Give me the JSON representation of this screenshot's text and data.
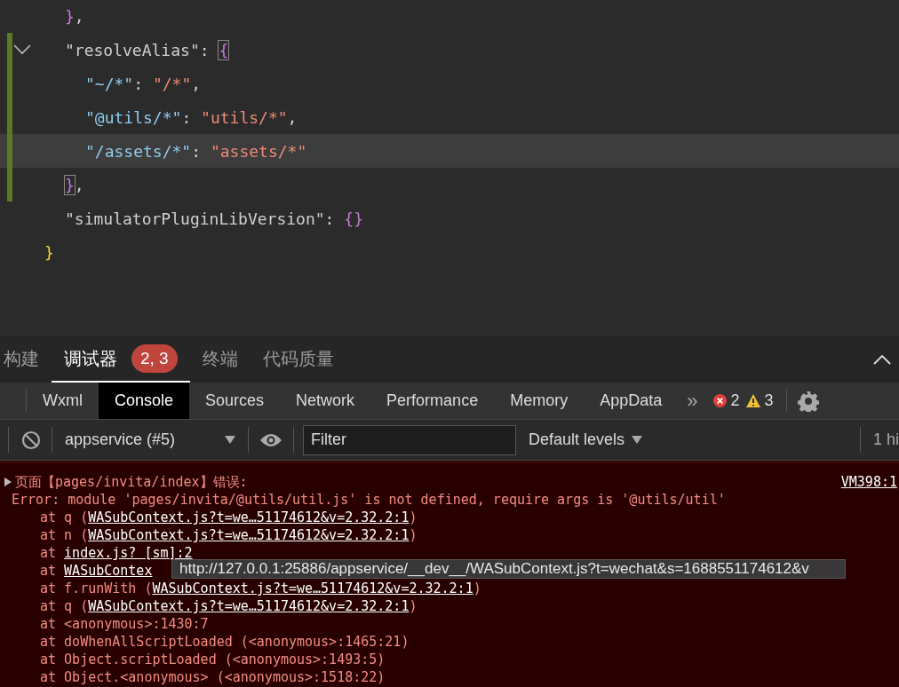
{
  "editor": {
    "lines": [
      {
        "modified": false,
        "current": false,
        "tokens": [
          {
            "text": "}",
            "kind": "brace"
          },
          {
            "text": ",",
            "kind": "punct"
          }
        ]
      },
      {
        "modified": true,
        "current": false,
        "expanded": true,
        "tokens": [
          {
            "text": "\"resolveAlias\"",
            "kind": "punct"
          },
          {
            "text": ": ",
            "kind": "punct"
          },
          {
            "text": "{",
            "kind": "brace-match"
          }
        ],
        "children": [
          {
            "modified": true,
            "current": false,
            "tokens": [
              {
                "text": "\"~/*\"",
                "kind": "key"
              },
              {
                "text": ": ",
                "kind": "punct"
              },
              {
                "text": "\"/*\"",
                "kind": "string"
              },
              {
                "text": ",",
                "kind": "punct"
              }
            ]
          },
          {
            "modified": true,
            "current": false,
            "tokens": [
              {
                "text": "\"@utils/*\"",
                "kind": "key"
              },
              {
                "text": ": ",
                "kind": "punct"
              },
              {
                "text": "\"utils/*\"",
                "kind": "string"
              },
              {
                "text": ",",
                "kind": "punct"
              }
            ]
          },
          {
            "modified": true,
            "current": true,
            "tokens": [
              {
                "text": "\"/assets/*\"",
                "kind": "key"
              },
              {
                "text": ": ",
                "kind": "punct"
              },
              {
                "text": "\"assets/*\"",
                "kind": "string"
              }
            ]
          }
        ]
      },
      {
        "modified": true,
        "current": false,
        "tokens": [
          {
            "text": "}",
            "kind": "brace-match"
          },
          {
            "text": ",",
            "kind": "punct"
          }
        ]
      },
      {
        "modified": false,
        "current": false,
        "tokens": [
          {
            "text": "\"simulatorPluginLibVersion\"",
            "kind": "punct"
          },
          {
            "text": ": ",
            "kind": "punct"
          },
          {
            "text": "{}",
            "kind": "brace"
          }
        ]
      }
    ],
    "closing": {
      "tokens": [
        {
          "text": "}",
          "kind": "outer"
        }
      ]
    }
  },
  "panel_tabs": [
    {
      "label": "构建",
      "selected": false
    },
    {
      "label": "调试器",
      "selected": true,
      "badge": "2, 3"
    },
    {
      "label": "终端",
      "selected": false
    },
    {
      "label": "代码质量",
      "selected": false
    }
  ],
  "devtools_tabs": [
    {
      "label": "Wxml",
      "selected": false
    },
    {
      "label": "Console",
      "selected": true
    },
    {
      "label": "Sources",
      "selected": false
    },
    {
      "label": "Network",
      "selected": false
    },
    {
      "label": "Performance",
      "selected": false
    },
    {
      "label": "Memory",
      "selected": false
    },
    {
      "label": "AppData",
      "selected": false
    }
  ],
  "more_tabs": "»",
  "error_count": "2",
  "warning_count": "3",
  "toolbar": {
    "context": "appservice (#5)",
    "filter_placeholder": "Filter",
    "levels": "Default levels",
    "hidden": "1 hi"
  },
  "console": {
    "summary": "页面【pages/invita/index】错误:",
    "source": "VM398:1",
    "error": "Error: module 'pages/invita/@utils/util.js' is not defined, require args is '@utils/util'",
    "frames": [
      {
        "prefix": "at q (",
        "link": "WASubContext.js?t=we…51174612&v=2.32.2:1",
        "suffix": ")"
      },
      {
        "prefix": "at n (",
        "link": "WASubContext.js?t=we…51174612&v=2.32.2:1",
        "suffix": ")"
      },
      {
        "prefix": "at ",
        "link": "index.js? [sm]:2"
      },
      {
        "prefix": "at ",
        "link": "WASubContex"
      },
      {
        "prefix": "at f.runWith (",
        "link": "WASubContext.js?t=we…51174612&v=2.32.2:1",
        "suffix": ")"
      },
      {
        "prefix": "at q (",
        "link": "WASubContext.js?t=we…51174612&v=2.32.2:1",
        "suffix": ")"
      },
      {
        "prefix": "at <anonymous>:1430:7"
      },
      {
        "prefix": "at doWhenAllScriptLoaded (<anonymous>:1465:21)"
      },
      {
        "prefix": "at Object.scriptLoaded (<anonymous>:1493:5)"
      },
      {
        "prefix": "at Object.<anonymous> (<anonymous>:1518:22)"
      }
    ],
    "tooltip": "http://127.0.0.1:25886/appservice/__dev__/WASubContext.js?t=wechat&s=1688551174612&v"
  }
}
